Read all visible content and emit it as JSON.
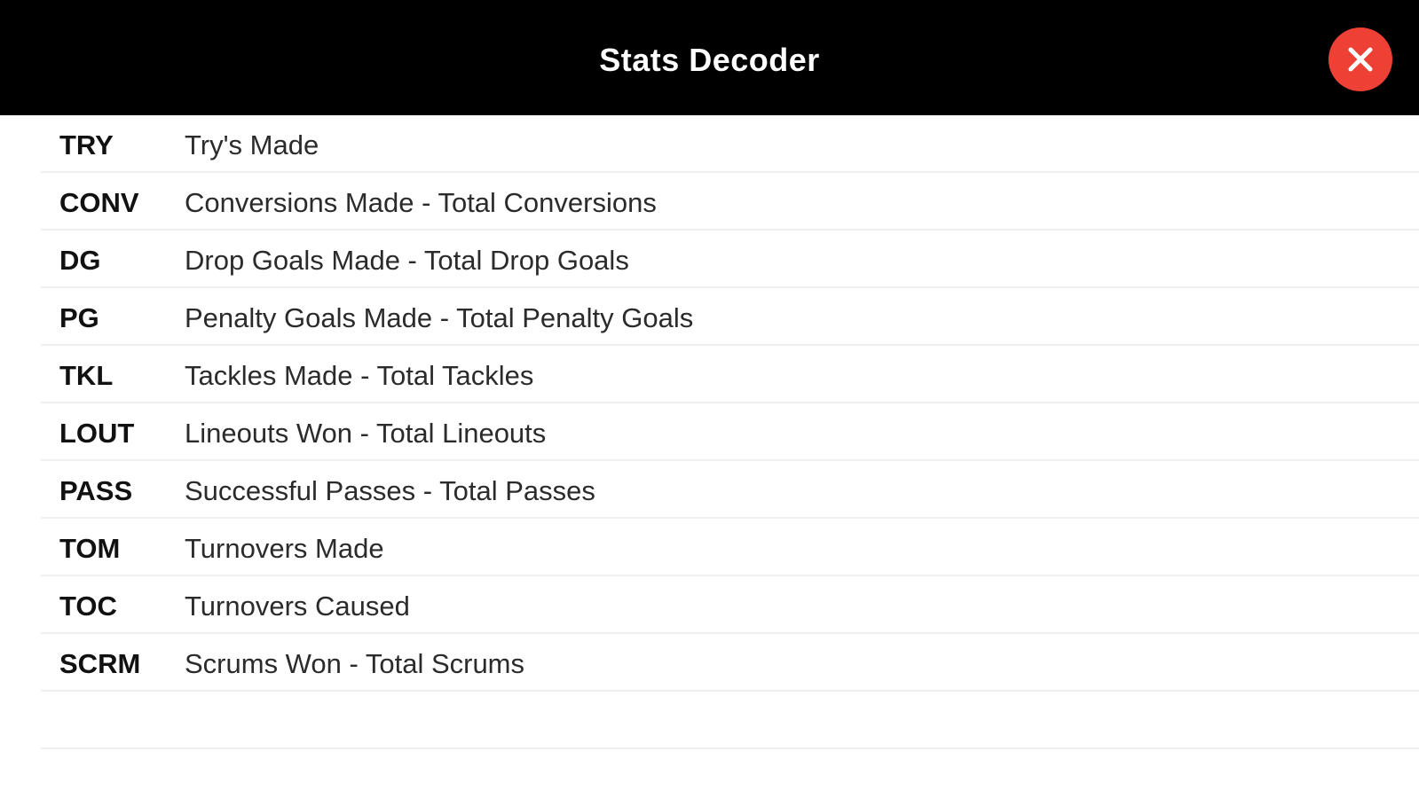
{
  "header": {
    "title": "Stats Decoder",
    "close_icon": "close-x-icon",
    "close_color": "#ee4035",
    "background": "#000000"
  },
  "rows": [
    {
      "abbr": "TRY",
      "description": "Try's Made"
    },
    {
      "abbr": "CONV",
      "description": "Conversions Made - Total Conversions"
    },
    {
      "abbr": "DG",
      "description": "Drop Goals Made - Total Drop Goals"
    },
    {
      "abbr": "PG",
      "description": "Penalty Goals Made - Total Penalty Goals"
    },
    {
      "abbr": "TKL",
      "description": "Tackles Made - Total Tackles"
    },
    {
      "abbr": "LOUT",
      "description": "Lineouts Won - Total Lineouts"
    },
    {
      "abbr": "PASS",
      "description": "Successful Passes - Total Passes"
    },
    {
      "abbr": "TOM",
      "description": "Turnovers Made"
    },
    {
      "abbr": "TOC",
      "description": "Turnovers Caused"
    },
    {
      "abbr": "SCRM",
      "description": "Scrums Won - Total Scrums"
    },
    {
      "abbr": "",
      "description": ""
    }
  ]
}
